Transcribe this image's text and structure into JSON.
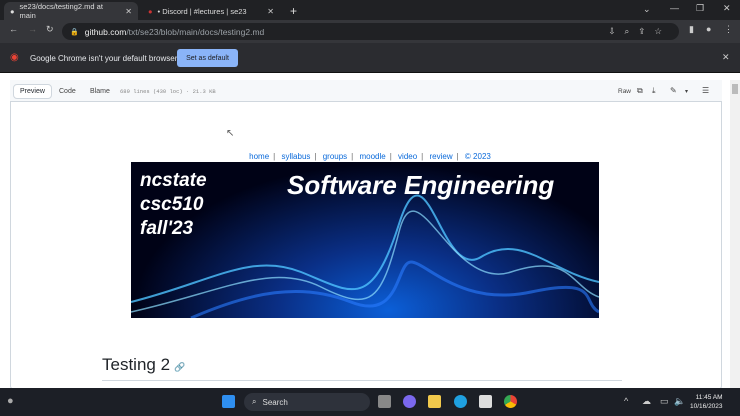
{
  "browser": {
    "tabs": [
      {
        "title": "se23/docs/testing2.md at main",
        "active": true
      },
      {
        "title": "• Discord | #lectures | se23",
        "active": false
      }
    ],
    "url_host": "github.com",
    "url_path": "/txt/se23/blob/main/docs/testing2.md",
    "banner_text": "Google Chrome isn't your default browser",
    "banner_button": "Set as default"
  },
  "file": {
    "views": [
      "Preview",
      "Code",
      "Blame"
    ],
    "active_view": "Preview",
    "meta": "689 lines (430 loc) · 21.3 KB",
    "raw_label": "Raw"
  },
  "content": {
    "nav_links": [
      "home",
      "syllabus",
      "groups",
      "moodle",
      "video",
      "review"
    ],
    "copyright": "© 2023",
    "banner_lines": [
      "ncstate",
      "csc510",
      "fall'23"
    ],
    "banner_title": "Software Engineering",
    "heading": "Testing 2"
  },
  "taskbar": {
    "search": "Search",
    "time": "11:45 AM",
    "date": "10/16/2023"
  },
  "colors": {
    "link": "#0969da",
    "chrome_dark": "#202124",
    "set_default": "#8ab4f8"
  }
}
